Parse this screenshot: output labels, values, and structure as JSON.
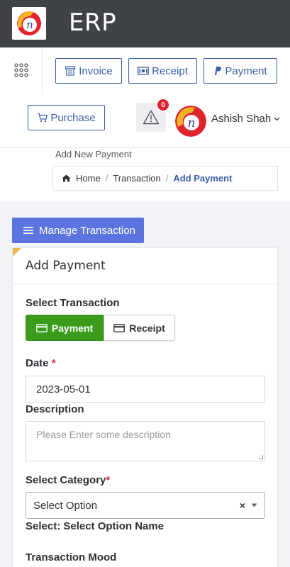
{
  "app": {
    "title": "ERP"
  },
  "header": {
    "quick_actions": [
      {
        "label": "Invoice"
      },
      {
        "label": "Receipt"
      },
      {
        "label": "Payment"
      },
      {
        "label": "Purchase"
      }
    ],
    "notification_count": "0",
    "user_name": "Ashish Shah"
  },
  "breadcrumb": {
    "page_heading": "Add New Payment",
    "items": [
      "Home",
      "Transaction",
      "Add Payment"
    ],
    "separator": "/"
  },
  "manage_button": {
    "label": "Manage Transaction"
  },
  "form": {
    "title": "Add Payment",
    "select_transaction_label": "Select Transaction",
    "transaction_options": [
      "Payment",
      "Receipt"
    ],
    "selected_transaction": "Payment",
    "date_label": "Date",
    "required_mark": "*",
    "date_value": "2023-05-01",
    "description_label": "Description",
    "description_placeholder": "Please Enter some description",
    "category_label": "Select Category",
    "category_value": "Select Option",
    "clear_symbol": "×",
    "select_hint": "Select: Select Option Name",
    "transaction_mood_label": "Transaction Mood"
  },
  "colors": {
    "topbar": "#3f4247",
    "accent_blue": "#3a5ea8",
    "manage_button": "#5b74e0",
    "active_green": "#3a9c1a",
    "badge_red": "#e0242e",
    "corner_yellow": "#e9b949"
  },
  "icons": {
    "grid": "apps-grid-icon",
    "invoice": "invoice-icon",
    "receipt": "money-bill-icon",
    "payment": "paypal-icon",
    "purchase": "cart-icon",
    "alert": "warning-icon",
    "home": "home-icon",
    "menu": "list-icon",
    "card": "credit-card-icon"
  }
}
